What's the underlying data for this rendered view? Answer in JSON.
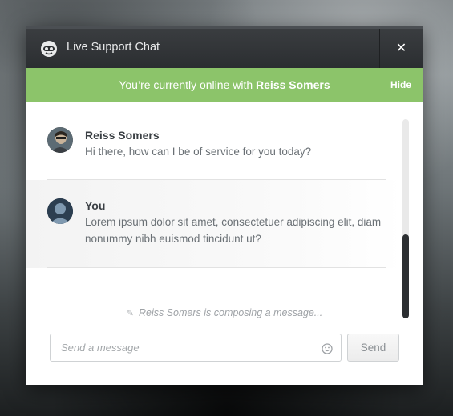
{
  "window": {
    "title": "Live Support Chat",
    "close_label": "✕"
  },
  "status": {
    "prefix": "You’re currently online with ",
    "agent_name": "Reiss Somers",
    "hide_label": "Hide"
  },
  "messages": [
    {
      "author": "Reiss Somers",
      "text": "Hi there, how can I be of service for you today?",
      "avatar": "agent-photo"
    },
    {
      "author": "You",
      "text": "Lorem ipsum dolor sit amet, consectetuer adipiscing elit, diam nonummy nibh euismod tincidunt ut?",
      "avatar": "user-silhouette"
    }
  ],
  "composing": {
    "icon": "pencil-icon",
    "text": "Reiss Somers is composing a message..."
  },
  "composer": {
    "placeholder": "Send a message",
    "value": "",
    "emoji_icon": "smiley-icon",
    "send_label": "Send"
  },
  "colors": {
    "status_bar": "#8cc46a",
    "titlebar": "#2b2e31",
    "scroll_thumb": "#2c2f32"
  }
}
